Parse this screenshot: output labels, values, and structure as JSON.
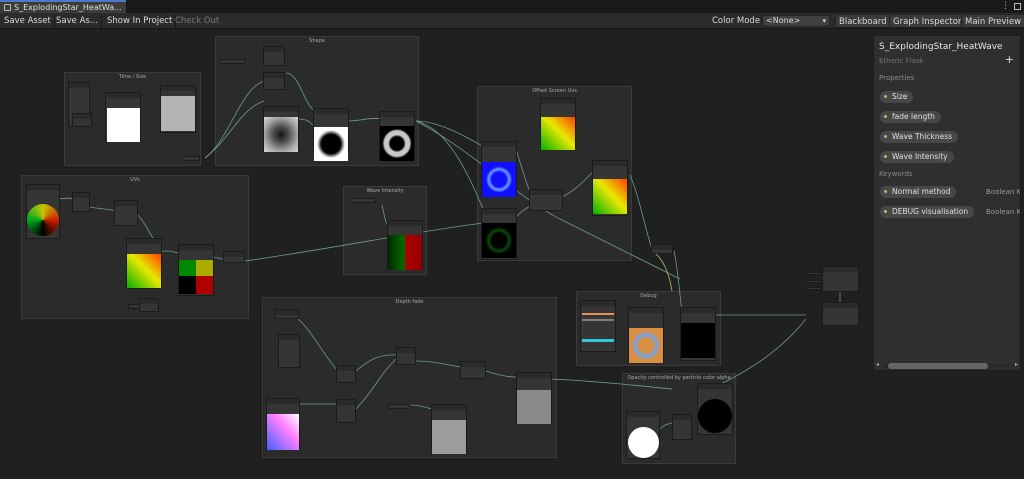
{
  "window": {
    "tab_title": "S_ExplodingStar_HeatWave",
    "tab_title_display": "S_ExplodingStar_HeatWa...",
    "menu_glyph": "⋮",
    "icons": [
      "shader-icon",
      "kebab-menu-icon",
      "maximize-icon"
    ]
  },
  "toolbar": {
    "save_asset": "Save Asset",
    "save_as": "Save As...",
    "show_in_project": "Show In Project",
    "check_out": "Check Out",
    "color_mode_label": "Color Mode",
    "color_mode_value": "<None>",
    "blackboard": "Blackboard",
    "graph_inspector": "Graph Inspector",
    "main_preview": "Main Preview"
  },
  "groups": [
    {
      "id": "time-size",
      "title": "Time / Size"
    },
    {
      "id": "shape",
      "title": "Shape"
    },
    {
      "id": "uvs",
      "title": "UVs"
    },
    {
      "id": "wave-intensity",
      "title": "Wave Intensity"
    },
    {
      "id": "offset-screen-uvs",
      "title": "Offset Screen Uvs"
    },
    {
      "id": "debug",
      "title": "Debug"
    },
    {
      "id": "depth-fade",
      "title": "Depth fade"
    },
    {
      "id": "opacity",
      "title": "Opacity controlled by particle color alpha"
    }
  ],
  "blackboard": {
    "title": "S_ExplodingStar_HeatWave",
    "subtitle": "Etheric Flask",
    "add_glyph": "+",
    "properties_header": "Properties",
    "properties": [
      "Size",
      "fade length",
      "Wave Thickness",
      "Wave Intensity"
    ],
    "keywords_header": "Keywords",
    "keywords": [
      {
        "name": "Normal method",
        "type": "Boolean Keyword"
      },
      {
        "name": "DEBUG visualisation",
        "type": "Boolean Keyword"
      }
    ],
    "scroll_left": "◂",
    "scroll_right": "▸"
  },
  "colors": {
    "accent_tab": "#4a7ac8",
    "property_dot": "#8fd16a",
    "wire": "#6a9c8c",
    "wire_yellow": "#b8b86a"
  }
}
